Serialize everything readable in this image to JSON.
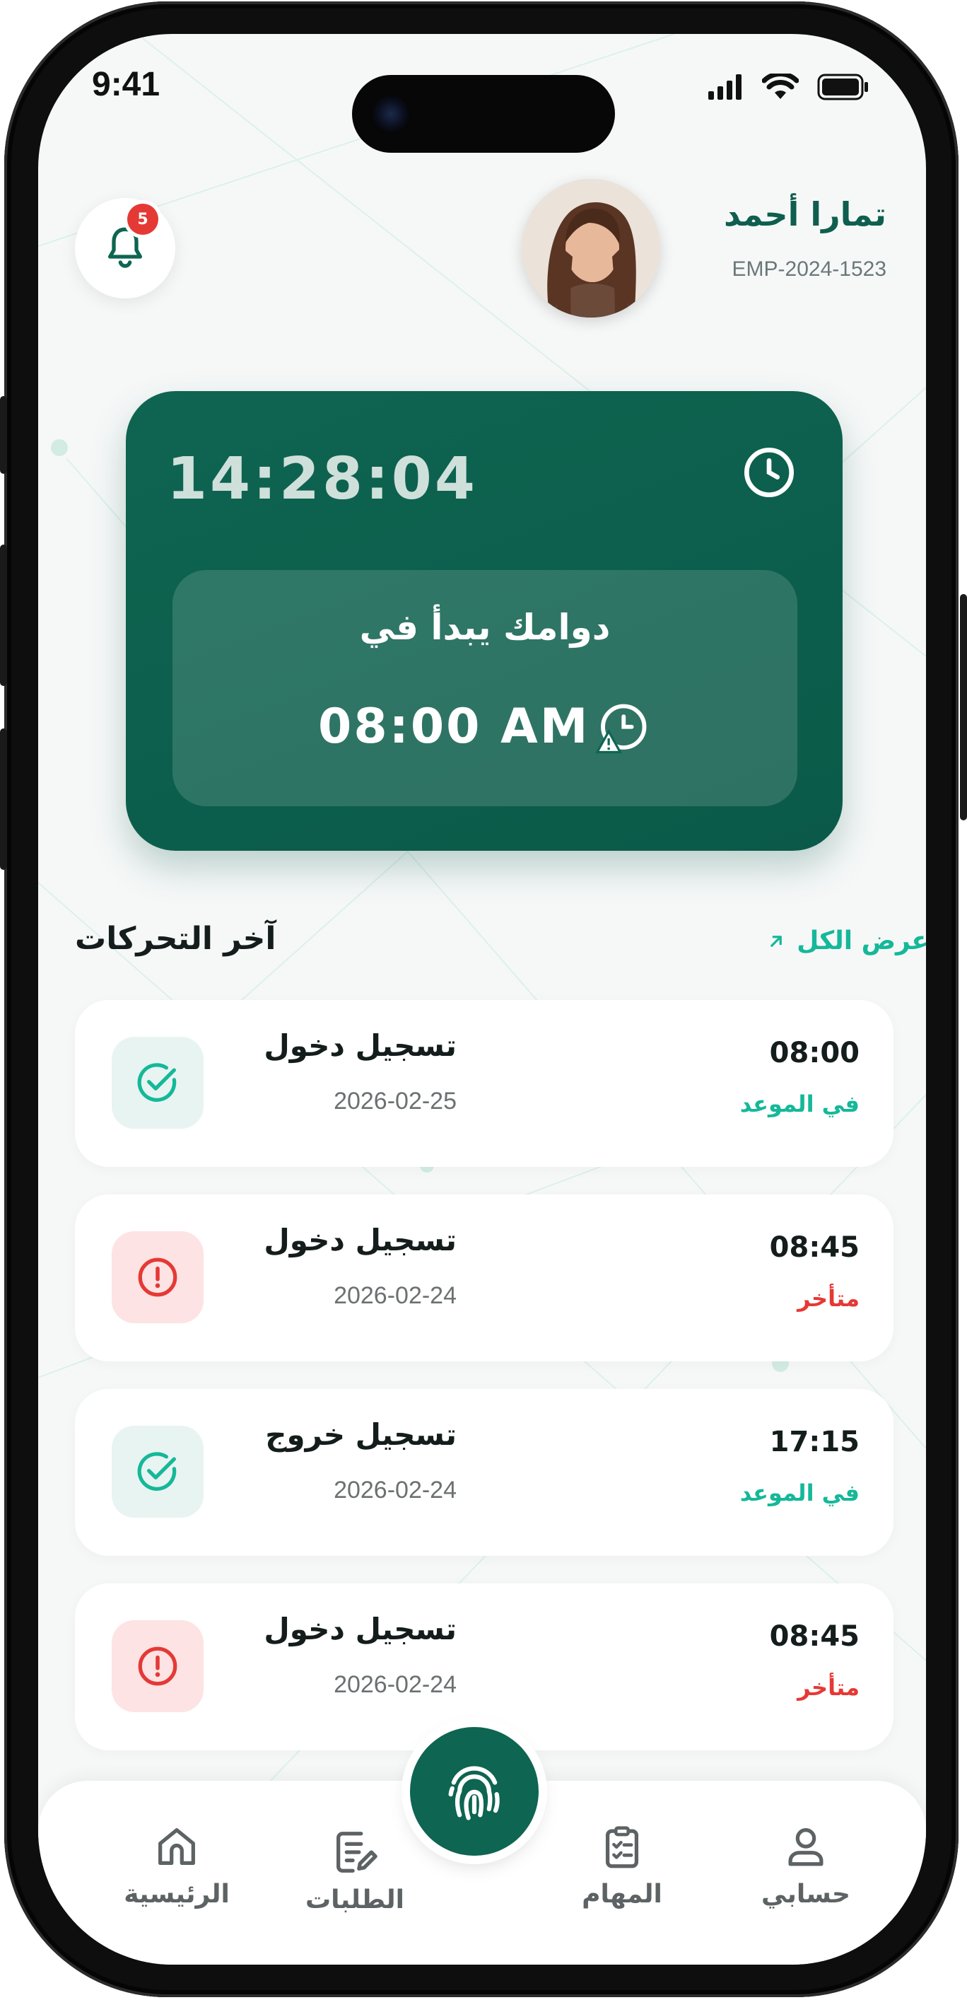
{
  "status_bar": {
    "time": "9:41"
  },
  "header": {
    "notifications_count": "5",
    "user_name": "تمارا أحمد",
    "employee_id": "EMP-2024-1523"
  },
  "clock_card": {
    "current_time": "14:28:04",
    "shift_label": "دوامك يبدأ في",
    "shift_start": "08:00 AM"
  },
  "recent": {
    "title": "آخر التحركات",
    "view_all": "عرض الكل",
    "items": [
      {
        "title": "تسجيل دخول",
        "date": "2026-02-25",
        "time": "08:00",
        "status": "في الموعد",
        "state": "on-time"
      },
      {
        "title": "تسجيل دخول",
        "date": "2026-02-24",
        "time": "08:45",
        "status": "متأخر",
        "state": "late"
      },
      {
        "title": "تسجيل خروج",
        "date": "2026-02-24",
        "time": "17:15",
        "status": "في الموعد",
        "state": "on-time"
      },
      {
        "title": "تسجيل دخول",
        "date": "2026-02-24",
        "time": "08:45",
        "status": "متأخر",
        "state": "late"
      }
    ]
  },
  "nav": {
    "home": "الرئيسية",
    "requests": "الطلبات",
    "tasks": "المهام",
    "account": "حسابي"
  },
  "colors": {
    "primary": "#0e6551",
    "accent": "#15b899",
    "late": "#e53935",
    "on_time_bg": "#e8f4f1",
    "late_bg": "#fde3e3"
  },
  "icons": {
    "bell": "bell-icon",
    "clock": "clock-icon",
    "shift_alert": "clock-alert-icon",
    "on_time": "check-circle-icon",
    "late": "alert-circle-icon",
    "arrow": "arrow-up-right-icon",
    "home": "home-icon",
    "requests": "document-edit-icon",
    "fingerprint": "fingerprint-icon",
    "tasks": "clipboard-check-icon",
    "account": "user-icon"
  }
}
